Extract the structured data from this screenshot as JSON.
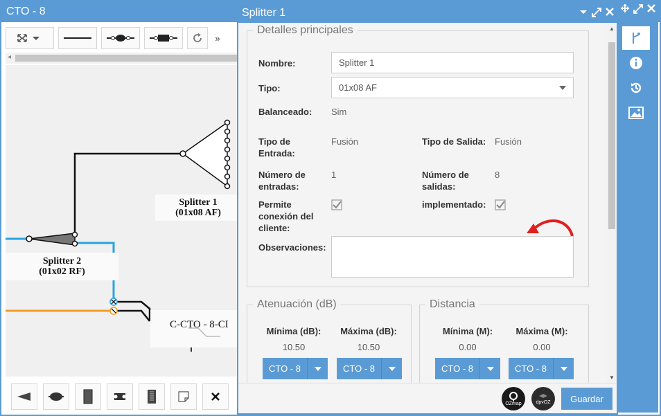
{
  "background_window": {
    "title": "CTO - 8",
    "toolbar_overflow": "»",
    "diagram": {
      "splitter1": {
        "name": "Splitter 1",
        "type": "(01x08 AF)"
      },
      "splitter2": {
        "name": "Splitter 2",
        "type": "(01x02 RF)"
      },
      "cto_label": "C-CTO - 8-CI"
    }
  },
  "dialog": {
    "title": "Splitter 1",
    "main_details": {
      "legend": "Detalles principales",
      "nombre_label": "Nombre:",
      "nombre_value": "Splitter 1",
      "tipo_label": "Tipo:",
      "tipo_value": "01x08 AF",
      "balanceado_label": "Balanceado:",
      "balanceado_value": "Sim",
      "tipo_entrada_label_1": "Tipo de",
      "tipo_entrada_label_2": "Entrada:",
      "tipo_entrada_value": "Fusión",
      "tipo_salida_label": "Tipo de Salida:",
      "tipo_salida_value": "Fusión",
      "num_entradas_label_1": "Número de",
      "num_entradas_label_2": "entradas:",
      "num_entradas_value": "1",
      "num_salidas_label_1": "Número de",
      "num_salidas_label_2": "salidas:",
      "num_salidas_value": "8",
      "permite_label_1": "Permite",
      "permite_label_2": "conexión del",
      "permite_label_3": "cliente:",
      "permite_checked": true,
      "implementado_label": "implementado:",
      "implementado_checked": true,
      "observaciones_label": "Observaciones:",
      "observaciones_value": ""
    },
    "atenuacion": {
      "legend": "Atenuación (dB)",
      "min_label": "Mínima (dB):",
      "min_value": "10.50",
      "max_label": "Máxima (dB):",
      "max_value": "10.50",
      "min_button": "CTO - 8",
      "max_button": "CTO - 8"
    },
    "distancia": {
      "legend": "Distancia",
      "min_label": "Mínima (M):",
      "min_value": "0.00",
      "max_label": "Máxima (M):",
      "max_value": "0.00",
      "min_button": "CTO - 8",
      "max_button": "CTO - 8"
    },
    "footer": {
      "logo1": "OZmap",
      "logo2": "dpvOZ",
      "save_label": "Guardar"
    }
  },
  "side_panel": {
    "icons": [
      "splitter-icon",
      "info-icon",
      "history-icon",
      "image-icon"
    ]
  },
  "colors": {
    "primary": "#5b9bd5",
    "annotation_arrow": "#e02020",
    "fiber_blue": "#2aa3e0",
    "fiber_orange": "#f39c24"
  }
}
